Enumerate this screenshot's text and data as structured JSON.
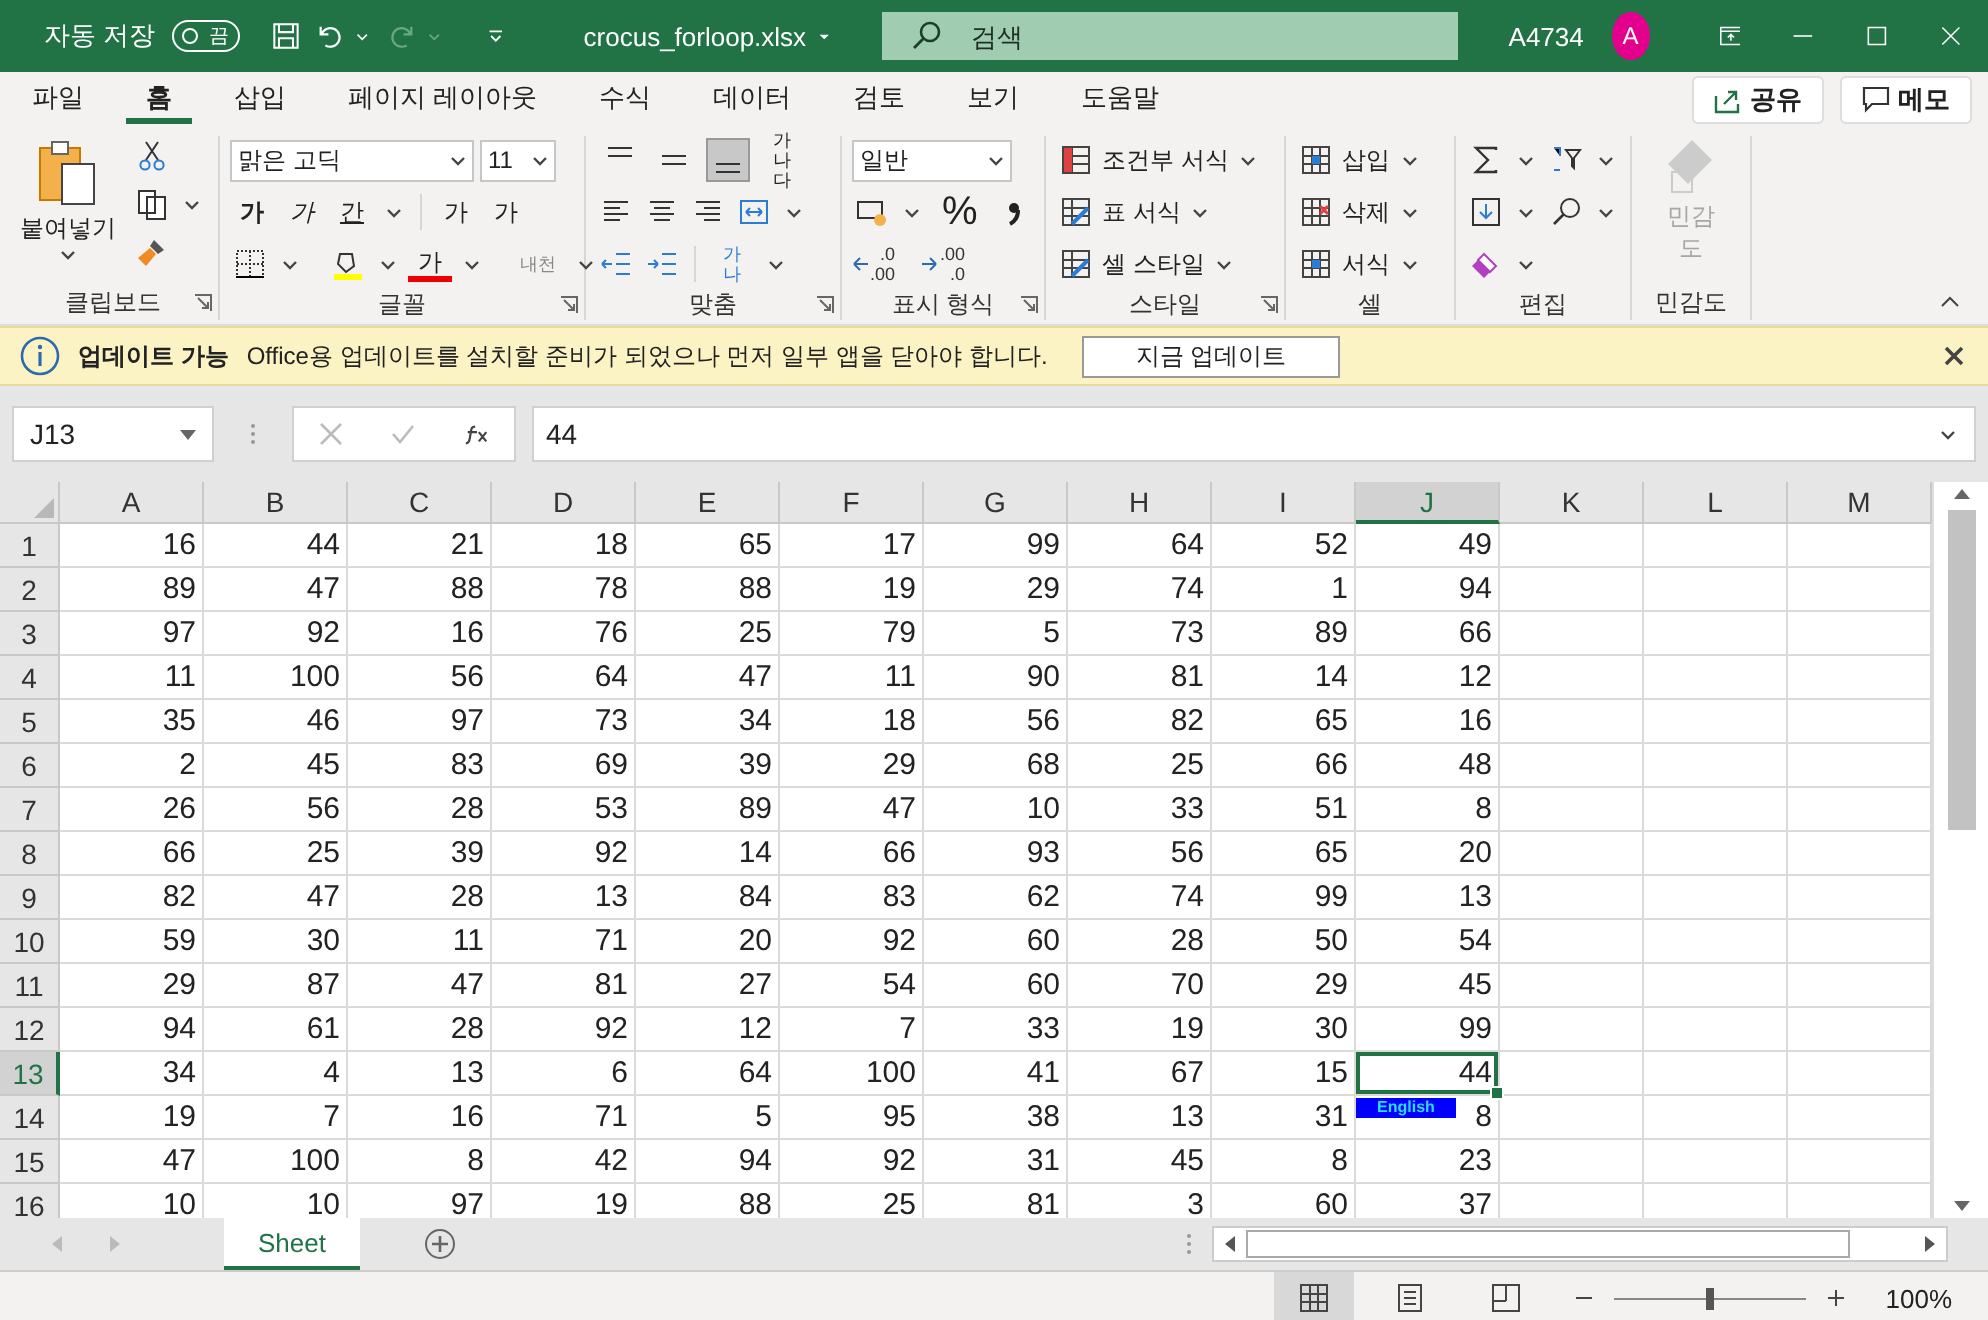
{
  "title_bar": {
    "autosave_label": "자동 저장",
    "autosave_state": "끔",
    "autosave_on": false,
    "filename": "crocus_forloop.xlsx",
    "search_placeholder": "검색",
    "user_id": "A4734",
    "avatar_initial": "A"
  },
  "menu_tabs": [
    {
      "label": "파일",
      "selected": false
    },
    {
      "label": "홈",
      "selected": true
    },
    {
      "label": "삽입",
      "selected": false
    },
    {
      "label": "페이지 레이아웃",
      "selected": false
    },
    {
      "label": "수식",
      "selected": false
    },
    {
      "label": "데이터",
      "selected": false
    },
    {
      "label": "검토",
      "selected": false
    },
    {
      "label": "보기",
      "selected": false
    },
    {
      "label": "도움말",
      "selected": false
    }
  ],
  "share_button": "공유",
  "comments_button": "메모",
  "ribbon": {
    "clipboard": {
      "label": "클립보드",
      "paste": "붙여넣기"
    },
    "font": {
      "label": "글꼴",
      "font_name": "맑은 고딕",
      "font_size": "11",
      "bold": "가",
      "italic": "가",
      "underline": "간",
      "grow": "가",
      "shrink": "가",
      "font_color": "가",
      "phonetic": "내천"
    },
    "alignment": {
      "label": "맞춤",
      "vertical": [
        {
          "kind": "top",
          "selected": false
        },
        {
          "kind": "middle",
          "selected": false
        },
        {
          "kind": "bottom",
          "selected": true
        }
      ],
      "wrap_text": "가나다",
      "orientation": "가나"
    },
    "number": {
      "label": "표시 형식",
      "format": "일반",
      "percent": "%",
      "decimals": [
        {
          "kind": "increase",
          "top": ".0",
          "bottom": ".00"
        },
        {
          "kind": "decrease",
          "top": ".00",
          "bottom": ".0"
        }
      ]
    },
    "styles": {
      "label": "스타일",
      "items": [
        {
          "kind": "conditional",
          "label": "조건부 서식"
        },
        {
          "kind": "table",
          "label": "표 서식"
        },
        {
          "kind": "cell",
          "label": "셀 스타일"
        }
      ]
    },
    "cells": {
      "label": "셀",
      "items": [
        {
          "kind": "insert",
          "label": "삽입"
        },
        {
          "kind": "delete",
          "label": "삭제"
        },
        {
          "kind": "format",
          "label": "서식"
        }
      ]
    },
    "editing": {
      "label": "편집"
    },
    "sensitivity": {
      "label": "민감도",
      "button": "민감도",
      "disabled": true
    }
  },
  "notification": {
    "title": "업데이트 가능",
    "message": "Office용 업데이트를 설치할 준비가 되었으나 먼저 일부 앱을 닫아야 합니다.",
    "button": "지금 업데이트"
  },
  "formula_bar": {
    "name_box": "J13",
    "formula": "44"
  },
  "sheet": {
    "columns": [
      {
        "label": "A",
        "selected": false
      },
      {
        "label": "B",
        "selected": false
      },
      {
        "label": "C",
        "selected": false
      },
      {
        "label": "D",
        "selected": false
      },
      {
        "label": "E",
        "selected": false
      },
      {
        "label": "F",
        "selected": false
      },
      {
        "label": "G",
        "selected": false
      },
      {
        "label": "H",
        "selected": false
      },
      {
        "label": "I",
        "selected": false
      },
      {
        "label": "J",
        "selected": true
      },
      {
        "label": "K",
        "selected": false
      },
      {
        "label": "L",
        "selected": false
      },
      {
        "label": "M",
        "selected": false
      }
    ],
    "rows": [
      {
        "label": "1",
        "selected": false,
        "cells": [
          "16",
          "44",
          "21",
          "18",
          "65",
          "17",
          "99",
          "64",
          "52",
          "49"
        ]
      },
      {
        "label": "2",
        "selected": false,
        "cells": [
          "89",
          "47",
          "88",
          "78",
          "88",
          "19",
          "29",
          "74",
          "1",
          "94"
        ]
      },
      {
        "label": "3",
        "selected": false,
        "cells": [
          "97",
          "92",
          "16",
          "76",
          "25",
          "79",
          "5",
          "73",
          "89",
          "66"
        ]
      },
      {
        "label": "4",
        "selected": false,
        "cells": [
          "11",
          "100",
          "56",
          "64",
          "47",
          "11",
          "90",
          "81",
          "14",
          "12"
        ]
      },
      {
        "label": "5",
        "selected": false,
        "cells": [
          "35",
          "46",
          "97",
          "73",
          "34",
          "18",
          "56",
          "82",
          "65",
          "16"
        ]
      },
      {
        "label": "6",
        "selected": false,
        "cells": [
          "2",
          "45",
          "83",
          "69",
          "39",
          "29",
          "68",
          "25",
          "66",
          "48"
        ]
      },
      {
        "label": "7",
        "selected": false,
        "cells": [
          "26",
          "56",
          "28",
          "53",
          "89",
          "47",
          "10",
          "33",
          "51",
          "8"
        ]
      },
      {
        "label": "8",
        "selected": false,
        "cells": [
          "66",
          "25",
          "39",
          "92",
          "14",
          "66",
          "93",
          "56",
          "65",
          "20"
        ]
      },
      {
        "label": "9",
        "selected": false,
        "cells": [
          "82",
          "47",
          "28",
          "13",
          "84",
          "83",
          "62",
          "74",
          "99",
          "13"
        ]
      },
      {
        "label": "10",
        "selected": false,
        "cells": [
          "59",
          "30",
          "11",
          "71",
          "20",
          "92",
          "60",
          "28",
          "50",
          "54"
        ]
      },
      {
        "label": "11",
        "selected": false,
        "cells": [
          "29",
          "87",
          "47",
          "81",
          "27",
          "54",
          "60",
          "70",
          "29",
          "45"
        ]
      },
      {
        "label": "12",
        "selected": false,
        "cells": [
          "94",
          "61",
          "28",
          "92",
          "12",
          "7",
          "33",
          "19",
          "30",
          "99"
        ]
      },
      {
        "label": "13",
        "selected": true,
        "cells": [
          "34",
          "4",
          "13",
          "6",
          "64",
          "100",
          "41",
          "67",
          "15",
          "44"
        ]
      },
      {
        "label": "14",
        "selected": false,
        "cells": [
          "19",
          "7",
          "16",
          "71",
          "5",
          "95",
          "38",
          "13",
          "31",
          "8"
        ]
      },
      {
        "label": "15",
        "selected": false,
        "cells": [
          "47",
          "100",
          "8",
          "42",
          "94",
          "92",
          "31",
          "45",
          "8",
          "23"
        ]
      },
      {
        "label": "16",
        "selected": false,
        "cells": [
          "10",
          "10",
          "97",
          "19",
          "88",
          "25",
          "81",
          "3",
          "60",
          "37"
        ]
      }
    ]
  },
  "ime_indicator": "English",
  "sheet_tabs": [
    {
      "label": "Sheet",
      "selected": true
    }
  ],
  "status_bar": {
    "views": [
      {
        "kind": "normal",
        "selected": true
      },
      {
        "kind": "page-layout",
        "selected": false
      },
      {
        "kind": "page-break",
        "selected": false
      }
    ],
    "zoom": {
      "level": 0.5,
      "label": "100%"
    }
  }
}
